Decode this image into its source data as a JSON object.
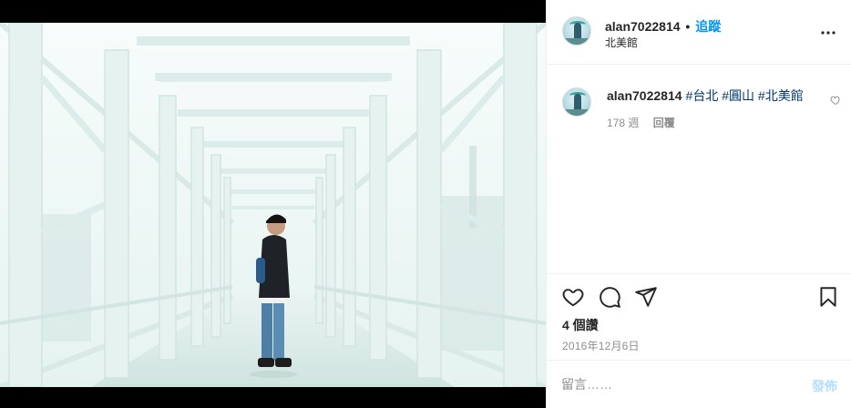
{
  "post": {
    "username": "alan7022814",
    "separator": "•",
    "follow_label": "追蹤",
    "location": "北美館",
    "more_icon": "more-horizontal-icon"
  },
  "caption": {
    "username": "alan7022814",
    "hashtags": [
      "#台北",
      "#圓山",
      "#北美館"
    ],
    "time_ago": "178 週",
    "reply_label": "回覆"
  },
  "actions": {
    "like_icon": "heart-icon",
    "comment_icon": "comment-icon",
    "share_icon": "paper-plane-icon",
    "save_icon": "bookmark-icon",
    "likes_text": "4 個讚",
    "date_text": "2016年12月6日"
  },
  "comment_box": {
    "placeholder": "留言……",
    "post_label": "發佈"
  },
  "colors": {
    "link_blue": "#0095f6",
    "hashtag_navy": "#00376b",
    "post_disabled": "#b2dffc",
    "muted_text": "#8e8e8e"
  }
}
